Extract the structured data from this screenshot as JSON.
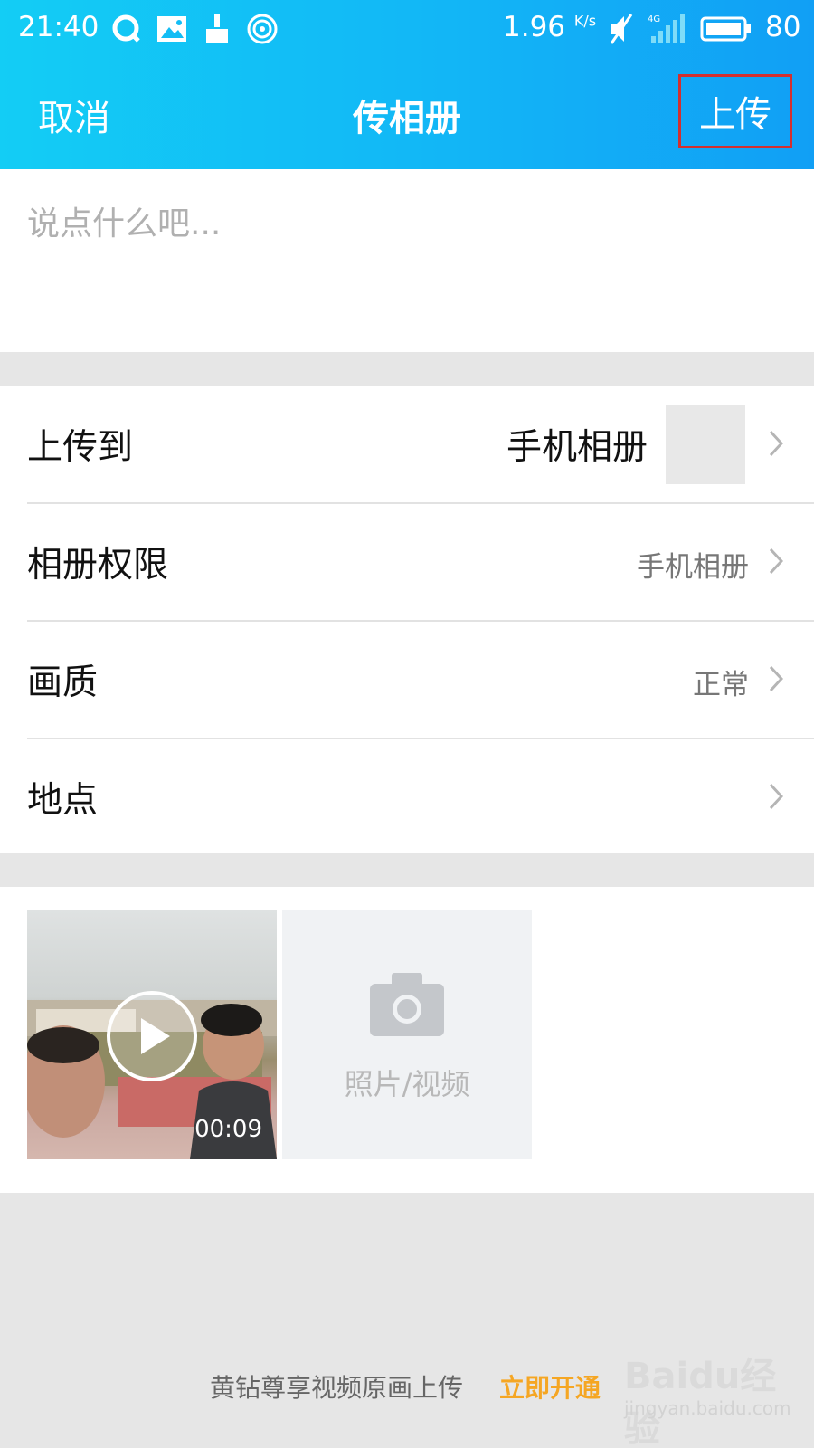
{
  "status_bar": {
    "time": "21:40",
    "speed": "1.96",
    "speed_unit": "K/s",
    "network": "4G",
    "battery": "80",
    "icons": [
      "qq-icon",
      "image-icon",
      "cleaner-icon",
      "hotspot-icon",
      "mute-icon",
      "signal-icon",
      "battery-icon"
    ]
  },
  "nav": {
    "cancel_label": "取消",
    "title": "传相册",
    "upload_label": "上传"
  },
  "compose": {
    "placeholder": "说点什么吧..."
  },
  "settings": {
    "upload_to_label": "上传到",
    "upload_to_value": "手机相册",
    "permission_label": "相册权限",
    "permission_value": "手机相册",
    "quality_label": "画质",
    "quality_value": "正常",
    "location_label": "地点"
  },
  "media": {
    "video_duration": "00:09",
    "add_label": "照片/视频"
  },
  "promo": {
    "text": "黄钻尊享视频原画上传",
    "link": "立即开通"
  },
  "watermark": {
    "brand": "Baidu经验",
    "sub": "jingyan.baidu.com"
  },
  "colors": {
    "header_start": "#13cdf5",
    "header_end": "#119ff5",
    "highlight_border": "#d32f2f",
    "promo_link": "#f5a623"
  }
}
